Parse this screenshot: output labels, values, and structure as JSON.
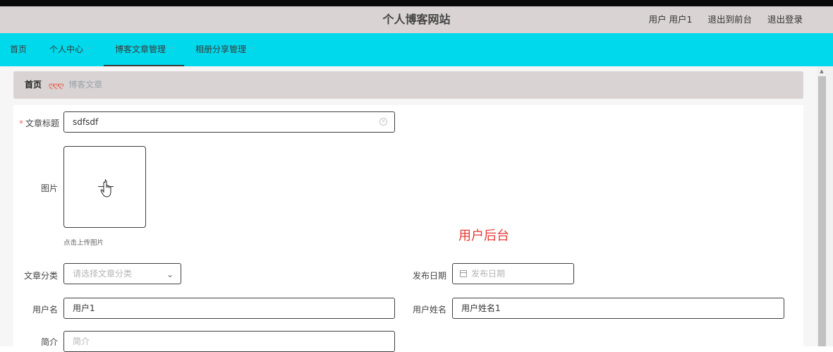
{
  "header": {
    "site_title": "个人博客网站",
    "user_text": "用户 用户1",
    "goto_front": "退出到前台",
    "logout": "退出登录"
  },
  "nav": {
    "items": [
      {
        "label": "首页",
        "has_dropdown": false
      },
      {
        "label": "个人中心",
        "has_dropdown": true
      },
      {
        "label": "博客文章管理",
        "has_dropdown": true,
        "active": true
      },
      {
        "label": "相册分享管理",
        "has_dropdown": true
      }
    ],
    "chevron": "﹀"
  },
  "breadcrumb": {
    "home": "首页",
    "separator": "ღღღ",
    "current": "博客文章"
  },
  "form": {
    "title_label": "文章标题",
    "title_required_mark": "*",
    "title_value": "sdfsdf",
    "image_label": "图片",
    "upload_tip": "点击上传图片",
    "category_label": "文章分类",
    "category_placeholder": "请选择文章分类",
    "publish_date_label": "发布日期",
    "publish_date_placeholder": "发布日期",
    "username_label": "用户名",
    "username_value": "用户1",
    "realname_label": "用户姓名",
    "realname_value": "用户姓名1",
    "intro_label": "简介",
    "intro_placeholder": "简介"
  },
  "overlay_text": "用户后台",
  "colors": {
    "nav_bg": "#00d9ec",
    "header_bg": "#d9d4d3",
    "required": "#f56c6c",
    "overlay": "#e53935"
  },
  "icons": [
    "clear-icon",
    "chevron-down-icon",
    "calendar-icon",
    "plus-icon",
    "hand-cursor-icon"
  ]
}
